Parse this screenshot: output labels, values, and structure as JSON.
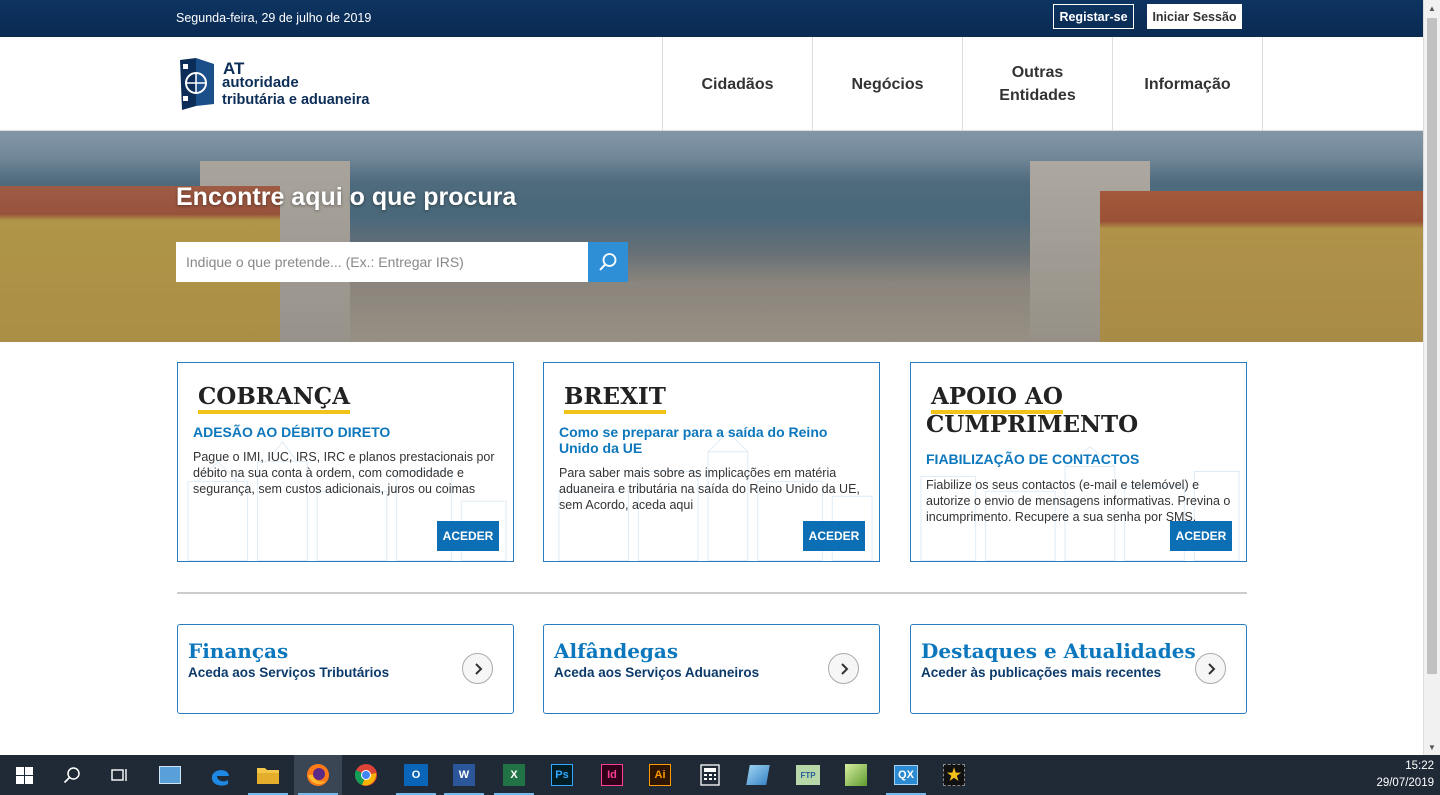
{
  "topbar": {
    "date": "Segunda-feira, 29 de julho de 2019",
    "register_label": "Registar-se",
    "login_label": "Iniciar Sessão"
  },
  "logo": {
    "line1": "AT",
    "line2": "autoridade",
    "line3": "tributária e aduaneira"
  },
  "nav": {
    "items": [
      {
        "label": "Cidadãos"
      },
      {
        "label": "Negócios"
      },
      {
        "label": "Outras\nEntidades"
      },
      {
        "label": "Informação"
      }
    ]
  },
  "hero": {
    "title": "Encontre aqui o que procura",
    "search_placeholder": "Indique o que pretende... (Ex.: Entregar IRS)"
  },
  "cards": [
    {
      "heading_line1": "COBRANÇA",
      "heading_line2": "",
      "subtitle": "ADESÃO AO DÉBITO DIRETO",
      "description": "Pague o IMI, IUC, IRS, IRC e planos prestacionais por débito na sua conta à ordem, com comodidade e segurança, sem custos adicionais, juros ou coimas",
      "button": "ACEDER"
    },
    {
      "heading_line1": "BREXIT",
      "heading_line2": "",
      "subtitle": "Como se preparar para a saída do Reino Unido da UE",
      "description": "Para saber mais sobre as implicações em matéria aduaneira e tributária na saída do Reino Unido da UE, sem Acordo, aceda aqui",
      "button": "ACEDER"
    },
    {
      "heading_line1": "APOIO AO",
      "heading_line2": "CUMPRIMENTO",
      "subtitle": "FIABILIZAÇÃO DE CONTACTOS",
      "description": "Fiabilize os seus contactos (e-mail e telemóvel) e autorize o envio de mensagens informativas. Previna o incumprimento. Recupere a sua senha por SMS.",
      "button": "ACEDER"
    }
  ],
  "links": [
    {
      "title": "Finanças",
      "subtitle": "Aceda aos Serviços Tributários"
    },
    {
      "title": "Alfândegas",
      "subtitle": "Aceda aos Serviços Aduaneiros"
    },
    {
      "title": "Destaques e Atualidades",
      "subtitle": "Aceder às publicações mais recentes"
    }
  ],
  "taskbar": {
    "time": "15:22",
    "date": "29/07/2019",
    "apps": [
      "windows-start",
      "search",
      "task-view",
      "network-drive",
      "edge",
      "file-explorer",
      "firefox",
      "chrome",
      "outlook",
      "word",
      "excel",
      "photoshop",
      "indesign",
      "illustrator",
      "calculator",
      "app-blue",
      "filezilla",
      "image-viewer",
      "qlik",
      "star-app"
    ]
  },
  "colors": {
    "topbar": "#0d3461",
    "accent_blue": "#0c77bd",
    "button_blue": "#0c6fb5",
    "search_button": "#2f8fd6",
    "underline_yellow": "#f2c41a",
    "taskbar": "#1f2a36"
  }
}
